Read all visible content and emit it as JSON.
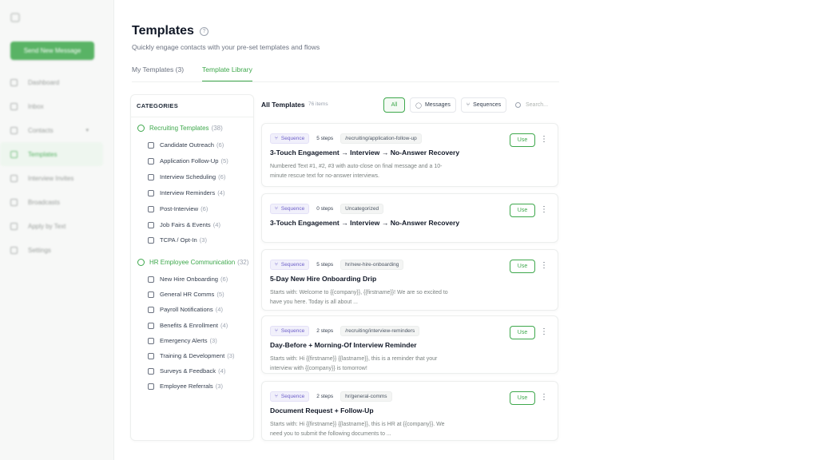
{
  "sidebar": {
    "logo_icon": "grid-icon",
    "send_button": "Send New Message",
    "items": [
      {
        "label": "Dashboard",
        "icon": "dashboard-icon"
      },
      {
        "label": "Inbox",
        "icon": "inbox-icon"
      },
      {
        "label": "Contacts",
        "icon": "contacts-icon"
      },
      {
        "label": "Templates",
        "icon": "templates-icon",
        "active": true
      },
      {
        "label": "Interview Invites",
        "icon": "calendar-icon"
      },
      {
        "label": "Broadcasts",
        "icon": "broadcast-icon"
      },
      {
        "label": "Apply by Text",
        "icon": "apply-icon"
      },
      {
        "label": "Settings",
        "icon": "gear-icon"
      }
    ]
  },
  "header": {
    "title": "Templates",
    "subtitle": "Quickly engage contacts with your pre-set templates and flows",
    "tabs": [
      {
        "label": "My Templates (3)"
      },
      {
        "label": "Template Library",
        "active": true
      }
    ]
  },
  "categories": {
    "heading": "CATEGORIES",
    "groups": [
      {
        "label": "Recruiting Templates",
        "count": "(38)",
        "icon": "users-icon",
        "items": [
          {
            "label": "Candidate Outreach",
            "count": "(6)",
            "icon": "chat-icon"
          },
          {
            "label": "Application Follow-Up",
            "count": "(5)",
            "icon": "mail-icon"
          },
          {
            "label": "Interview Scheduling",
            "count": "(6)",
            "icon": "bell-icon"
          },
          {
            "label": "Interview Reminders",
            "count": "(4)",
            "icon": "bell-icon"
          },
          {
            "label": "Post-Interview",
            "count": "(6)",
            "icon": "check-circle-icon"
          },
          {
            "label": "Job Fairs & Events",
            "count": "(4)",
            "icon": "calendar-icon"
          },
          {
            "label": "TCPA / Opt-In",
            "count": "(3)",
            "icon": "shield-icon"
          }
        ]
      },
      {
        "label": "HR Employee Communication",
        "count": "(32)",
        "icon": "building-icon",
        "items": [
          {
            "label": "New Hire Onboarding",
            "count": "(6)",
            "icon": "user-icon"
          },
          {
            "label": "General HR Comms",
            "count": "(5)",
            "icon": "mail-icon"
          },
          {
            "label": "Payroll Notifications",
            "count": "(4)",
            "icon": "dollar-icon"
          },
          {
            "label": "Benefits & Enrollment",
            "count": "(4)",
            "icon": "heart-icon"
          },
          {
            "label": "Emergency Alerts",
            "count": "(3)",
            "icon": "bell-icon"
          },
          {
            "label": "Training & Development",
            "count": "(3)",
            "icon": "book-icon"
          },
          {
            "label": "Surveys & Feedback",
            "count": "(4)",
            "icon": "star-icon"
          },
          {
            "label": "Employee Referrals",
            "count": "(3)",
            "icon": "gift-icon"
          }
        ]
      }
    ]
  },
  "list": {
    "title": "All Templates",
    "count": "76 items",
    "filters": [
      {
        "label": "All",
        "active": true
      },
      {
        "label": "Messages",
        "icon": "chat-icon"
      },
      {
        "label": "Sequences",
        "icon": "branch-icon"
      }
    ],
    "search_placeholder": "Search..."
  },
  "templates": [
    {
      "type": "Sequence",
      "steps": "5 steps",
      "path": "/recruiting/application-follow-up",
      "title": "3-Touch Engagement → Interview → No-Answer Recovery",
      "description": "Numbered Text #1, #2, #3 with auto-close on final message and a 10-minute rescue text for no-answer interviews.",
      "use_label": "Use"
    },
    {
      "type": "Sequence",
      "steps": "0 steps",
      "path": "Uncategorized",
      "title": "3-Touch Engagement → Interview → No-Answer Recovery",
      "description": "",
      "use_label": "Use"
    },
    {
      "type": "Sequence",
      "steps": "5 steps",
      "path": "hr/new-hire-onboarding",
      "title": "5-Day New Hire Onboarding Drip",
      "description": "Starts with: Welcome to {{company}}, {{firstname}}! We are so excited to have you here. Today is all about ...",
      "use_label": "Use"
    },
    {
      "type": "Sequence",
      "steps": "2 steps",
      "path": "/recruiting/interview-reminders",
      "title": "Day-Before + Morning-Of Interview Reminder",
      "description": "Starts with: Hi {{firstname}} {{lastname}}, this is a reminder that your interview with {{company}} is tomorrow!",
      "use_label": "Use"
    },
    {
      "type": "Sequence",
      "steps": "2 steps",
      "path": "hr/general-comms",
      "title": "Document Request + Follow-Up",
      "description": "Starts with: Hi {{firstname}} {{lastname}}, this is HR at {{company}}. We need you to submit the following documents to ...",
      "use_label": "Use"
    }
  ],
  "colors": {
    "brand": "#3ea84c",
    "sequence_chip": "#6d5fc9"
  }
}
